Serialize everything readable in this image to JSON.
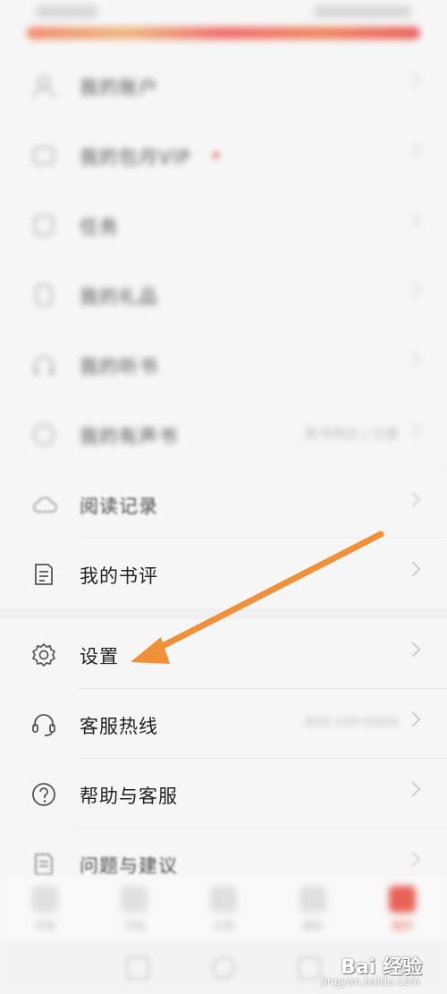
{
  "menu": [
    {
      "label": "我的账户",
      "icon": "user-icon",
      "style": "blurred"
    },
    {
      "label": "我的包月VIP",
      "icon": "vip-icon",
      "style": "blurred",
      "badge": true
    },
    {
      "label": "任务",
      "icon": "task-icon",
      "style": "blurred"
    },
    {
      "label": "我的礼品",
      "icon": "gift-icon",
      "style": "blurred"
    },
    {
      "label": "我的听书",
      "icon": "headphones-icon",
      "style": "blurred"
    },
    {
      "label": "我的有声书",
      "icon": "circle-icon",
      "style": "blurred",
      "value": "新书到达 | 已更"
    },
    {
      "label": "阅读记录",
      "icon": "cloud-icon",
      "style": "semi"
    },
    {
      "label": "我的书评",
      "icon": "note-icon",
      "style": "clear"
    },
    {
      "label": "设置",
      "icon": "gear-icon",
      "style": "clear"
    },
    {
      "label": "客服热线",
      "icon": "headset-icon",
      "style": "clear",
      "value": "400-100-0000"
    },
    {
      "label": "帮助与客服",
      "icon": "help-icon",
      "style": "clear"
    },
    {
      "label": "问题与建议",
      "icon": "feedback-icon",
      "style": "semi"
    }
  ],
  "bottom_nav": [
    {
      "label": "书架",
      "active": false
    },
    {
      "label": "书城",
      "active": false
    },
    {
      "label": "分类",
      "active": false
    },
    {
      "label": "福利",
      "active": false
    },
    {
      "label": "我的",
      "active": true
    }
  ],
  "watermark": {
    "main": "Bai 经验",
    "sub": "jingyan.baidu.com"
  },
  "colors": {
    "arrow": "#f0913a",
    "accent": "#e64a3c"
  }
}
